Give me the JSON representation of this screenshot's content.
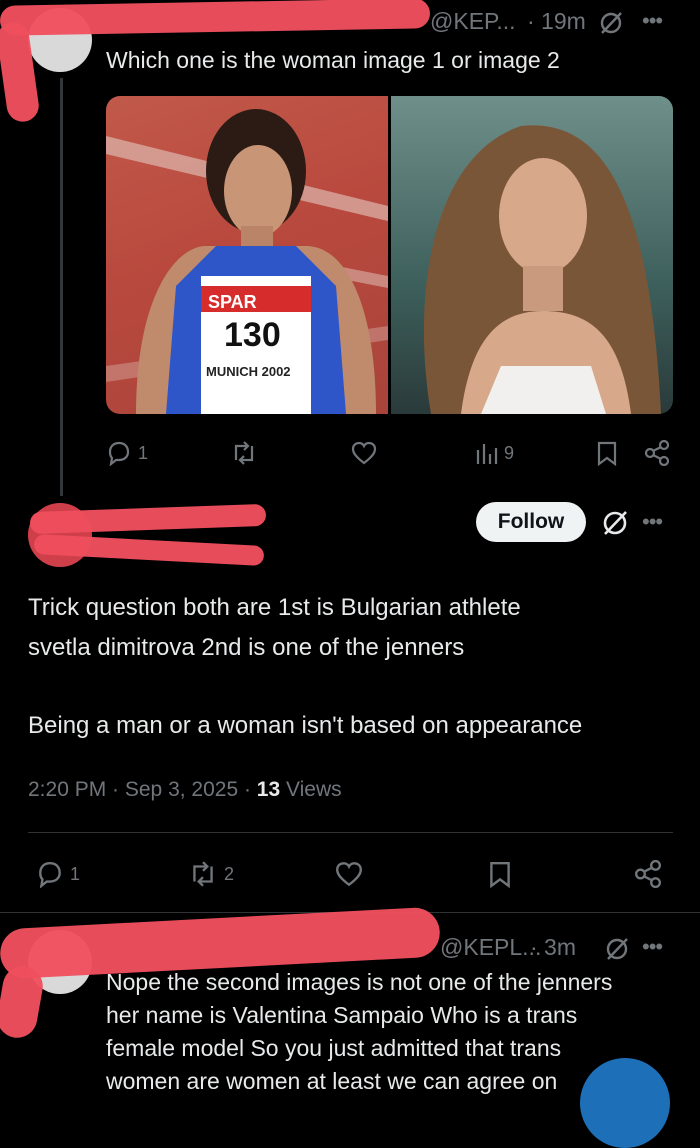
{
  "tweet1": {
    "handle": "@KEP...",
    "time": "· 19m",
    "text": "Which one is the woman image 1 or image 2",
    "image1": {
      "bib_brand": "SPAR",
      "bib_number": "130",
      "bib_event": "MUNICH 2002"
    },
    "actions": {
      "replies": "1",
      "views": "9"
    }
  },
  "tweet2": {
    "follow_label": "Follow",
    "text_line1": "Trick question both are 1st is Bulgarian athlete",
    "text_line2": "svetla dimitrova 2nd is one of the jenners",
    "text_line3": "Being a man or a woman isn't based on appearance",
    "timestamp": "2:20 PM · Sep 3, 2025 · ",
    "views_count": "13",
    "views_label": "Views",
    "actions": {
      "replies": "1",
      "reposts": "2"
    }
  },
  "tweet3": {
    "handle": "@KEPL...",
    "time": "· 3m",
    "text_line1": "Nope the second images is not one of the jenners",
    "text_line2": "her name is Valentina Sampaio Who is a trans",
    "text_line3": "female model   So you just admitted that trans",
    "text_line4": "women are women at least we can agree on"
  },
  "colors": {
    "background": "#000000",
    "text": "#e7e9ea",
    "muted": "#71767b",
    "redaction": "#ef4f5d",
    "follow_bg": "#eff3f4"
  }
}
